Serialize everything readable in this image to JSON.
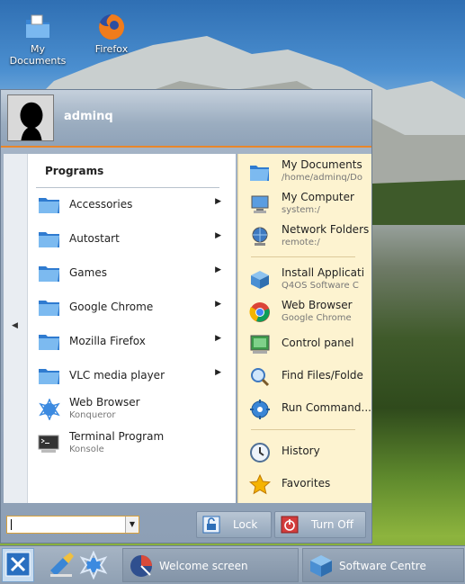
{
  "desktop": {
    "icons": [
      {
        "label": "My\nDocuments",
        "icon": "folder-icon"
      },
      {
        "label": "Firefox",
        "icon": "firefox-icon"
      }
    ]
  },
  "menu": {
    "username": "adminq",
    "programs_title": "Programs",
    "programs": [
      {
        "label": "Accessories",
        "submenu": true
      },
      {
        "label": "Autostart",
        "submenu": true
      },
      {
        "label": "Games",
        "submenu": true
      },
      {
        "label": "Google Chrome",
        "submenu": true
      },
      {
        "label": "Mozilla Firefox",
        "submenu": true
      },
      {
        "label": "VLC media player",
        "submenu": true
      }
    ],
    "apps": [
      {
        "label": "Web Browser",
        "sub": "Konqueror"
      },
      {
        "label": "Terminal Program",
        "sub": "Konsole"
      }
    ],
    "places": [
      {
        "label": "My Documents",
        "sub": "/home/adminq/Do"
      },
      {
        "label": "My Computer",
        "sub": "system:/"
      },
      {
        "label": "Network Folders",
        "sub": "remote:/"
      }
    ],
    "system": [
      {
        "label": "Install Applicati",
        "sub": "Q4OS Software C"
      },
      {
        "label": "Web Browser",
        "sub": "Google Chrome"
      },
      {
        "label": "Control panel",
        "sub": ""
      },
      {
        "label": "Find Files/Folde",
        "sub": ""
      },
      {
        "label": "Run Command...",
        "sub": ""
      }
    ],
    "extras": [
      {
        "label": "History"
      },
      {
        "label": "Favorites"
      }
    ],
    "footer": {
      "search_value": "",
      "lock_label": "Lock",
      "turnoff_label": "Turn Off"
    }
  },
  "taskbar": {
    "tasks": [
      {
        "label": "Welcome screen"
      },
      {
        "label": "Software Centre"
      }
    ]
  },
  "colors": {
    "accent": "#e9862b",
    "right_pane_bg": "#fdf3d0",
    "folder_blue": "#3a86d6"
  }
}
